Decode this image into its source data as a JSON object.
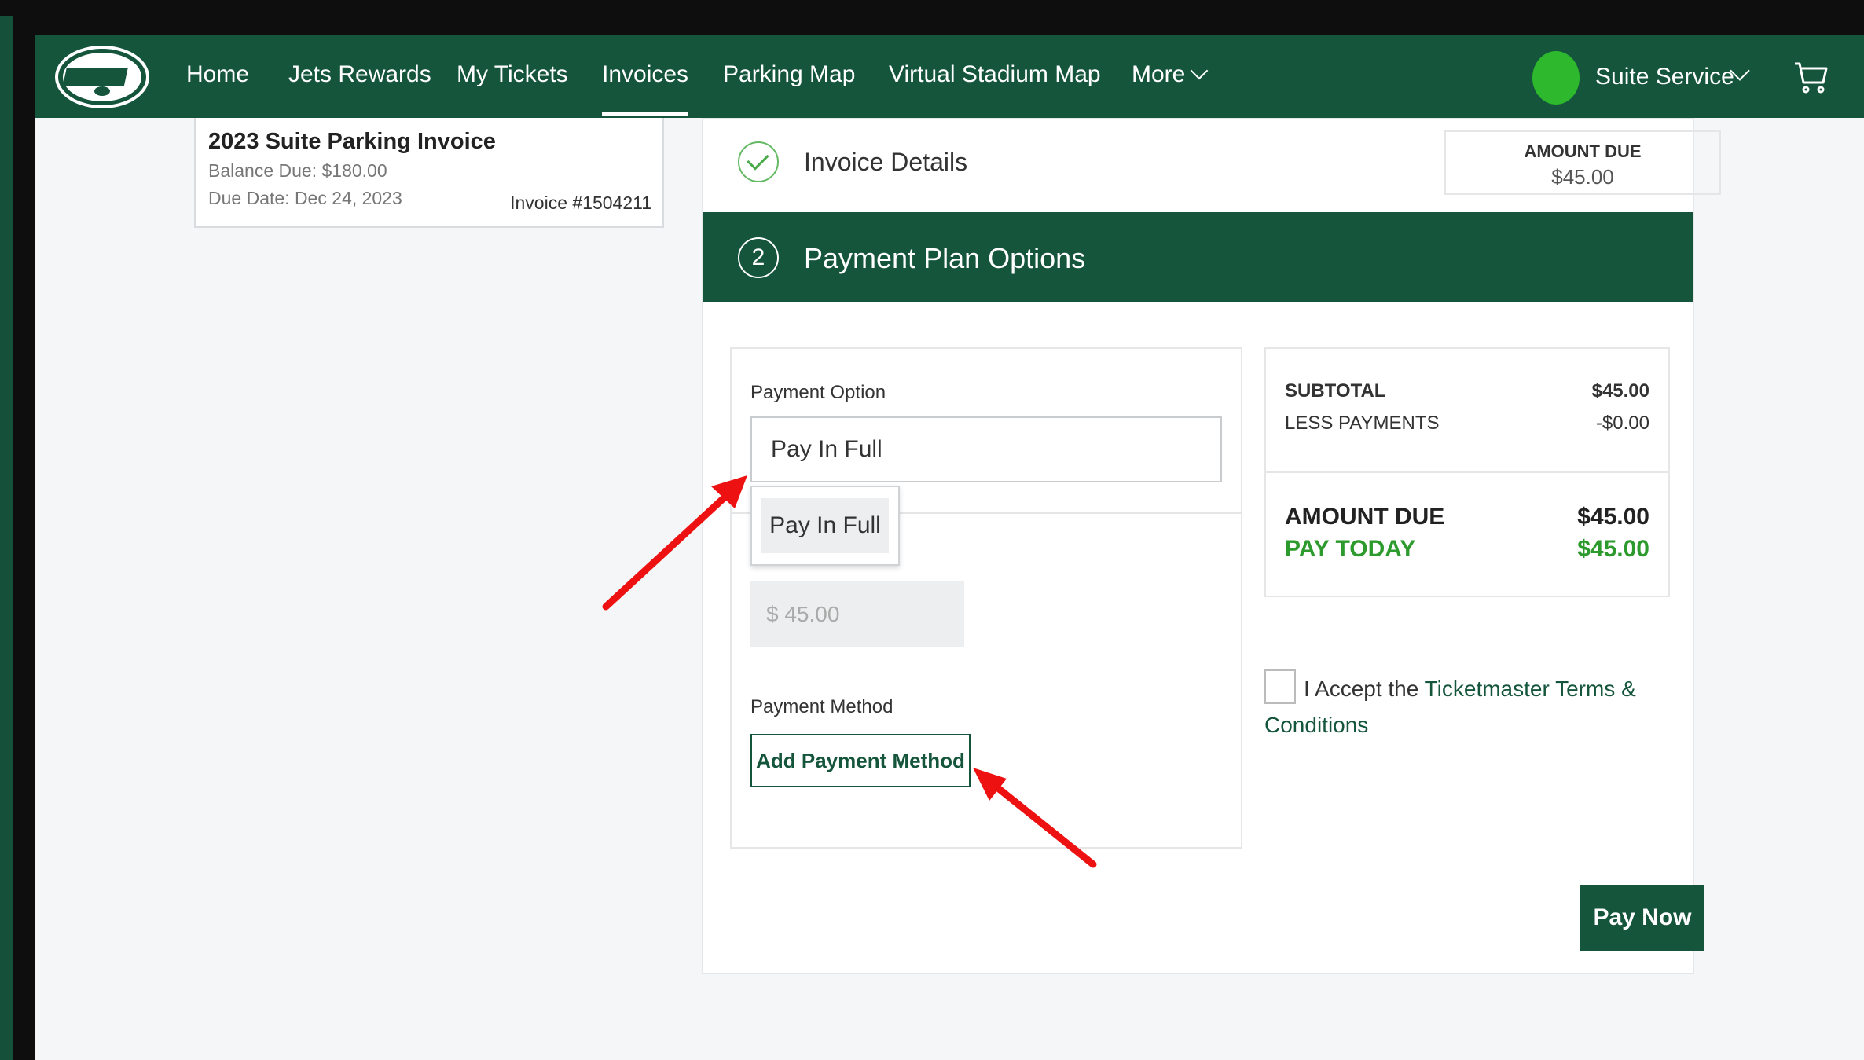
{
  "nav": {
    "items": [
      "Home",
      "Jets Rewards",
      "My Tickets",
      "Invoices",
      "Parking Map",
      "Virtual Stadium Map",
      "More"
    ],
    "active": "Invoices",
    "user_name": "Suite Service"
  },
  "invoice_card": {
    "title": "2023 Suite Parking Invoice",
    "balance_due": "Balance Due: $180.00",
    "due_date": "Due Date: Dec 24, 2023",
    "invoice_number": "Invoice #1504211"
  },
  "invoice_details": {
    "heading": "Invoice Details",
    "amount_due_label": "AMOUNT DUE",
    "amount_due_value": "$45.00"
  },
  "payment_plan": {
    "step": "2",
    "heading": "Payment Plan Options",
    "payment_option_label": "Payment Option",
    "selected_option": "Pay In Full",
    "dropdown_options": [
      "Pay In Full"
    ],
    "amount_value": "$ 45.00",
    "payment_method_label": "Payment Method",
    "add_payment_method": "Add Payment Method"
  },
  "summary": {
    "subtotal_label": "SUBTOTAL",
    "subtotal_value": "$45.00",
    "less_payments_label": "LESS PAYMENTS",
    "less_payments_value": "-$0.00",
    "amount_due_label": "AMOUNT DUE",
    "amount_due_value": "$45.00",
    "pay_today_label": "PAY TODAY",
    "pay_today_value": "$45.00"
  },
  "terms": {
    "prefix": "I Accept the ",
    "link": "Ticketmaster Terms & Conditions"
  },
  "pay_now": "Pay Now",
  "colors": {
    "brand_green": "#14553c",
    "accent_green": "#2d9a2d",
    "annotation_red": "#ee1111"
  }
}
